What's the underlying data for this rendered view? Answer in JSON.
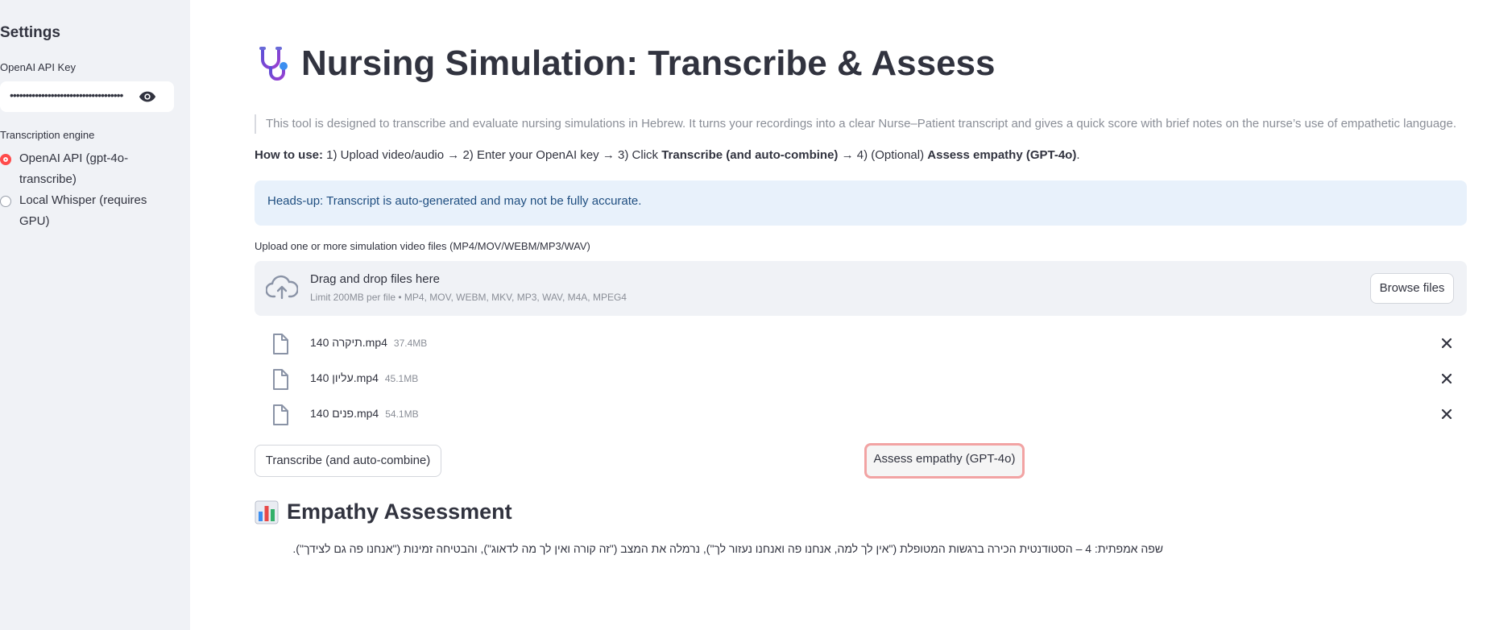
{
  "sidebar": {
    "title": "Settings",
    "api_key_label": "OpenAI API Key",
    "api_key_value": "••••••••••••••••••••••••••••••••••••",
    "engine_label": "Transcription engine",
    "engine_options": [
      {
        "label": "OpenAI API (gpt-4o-transcribe)",
        "selected": true
      },
      {
        "label": "Local Whisper (requires GPU)",
        "selected": false
      }
    ]
  },
  "main": {
    "title": "Nursing Simulation: Transcribe & Assess",
    "intro": "This tool is designed to transcribe and evaluate nursing simulations in Hebrew. It turns your recordings into a clear Nurse–Patient transcript and gives a quick score with brief notes on the nurse’s use of empathetic language.",
    "howto": {
      "lead": "How to use:",
      "text1": " 1) Upload video/audio → 2) Enter your OpenAI key → 3) Click ",
      "bold1": "Transcribe (and auto-combine)",
      "text2": " → 4) (Optional) ",
      "bold2": "Assess empathy (GPT-4o)",
      "text3": "."
    },
    "alert": "Heads-up: Transcript is auto-generated and may not be fully accurate.",
    "uploader": {
      "label": "Upload one or more simulation video files (MP4/MOV/WEBM/MP3/WAV)",
      "drag_text": "Drag and drop files here",
      "limit_text": "Limit 200MB per file • MP4, MOV, WEBM, MKV, MP3, WAV, M4A, MPEG4",
      "browse_label": "Browse files"
    },
    "files": [
      {
        "name": "140 תיקרה.mp4",
        "size": "37.4MB"
      },
      {
        "name": "140 עליון.mp4",
        "size": "45.1MB"
      },
      {
        "name": "140 פנים.mp4",
        "size": "54.1MB"
      }
    ],
    "buttons": {
      "transcribe": "Transcribe (and auto-combine)",
      "assess": "Assess empathy (GPT-4o)"
    },
    "assessment": {
      "heading": "Empathy Assessment",
      "text": "שפה אמפתית: 4 – הסטודנטית הכירה ברגשות המטופלת (\"אין לך למה, אנחנו פה ואנחנו נעזור לך\"), נרמלה את המצב (\"זה קורה ואין לך מה לדאוג\"), והבטיחה זמינות (\"אנחנו פה גם לצידך\")."
    }
  },
  "colors": {
    "accent": "#ff4b4b",
    "sidebar_bg": "#f0f2f6",
    "alert_bg": "#e8f1fb",
    "alert_text": "#1f4e80"
  }
}
